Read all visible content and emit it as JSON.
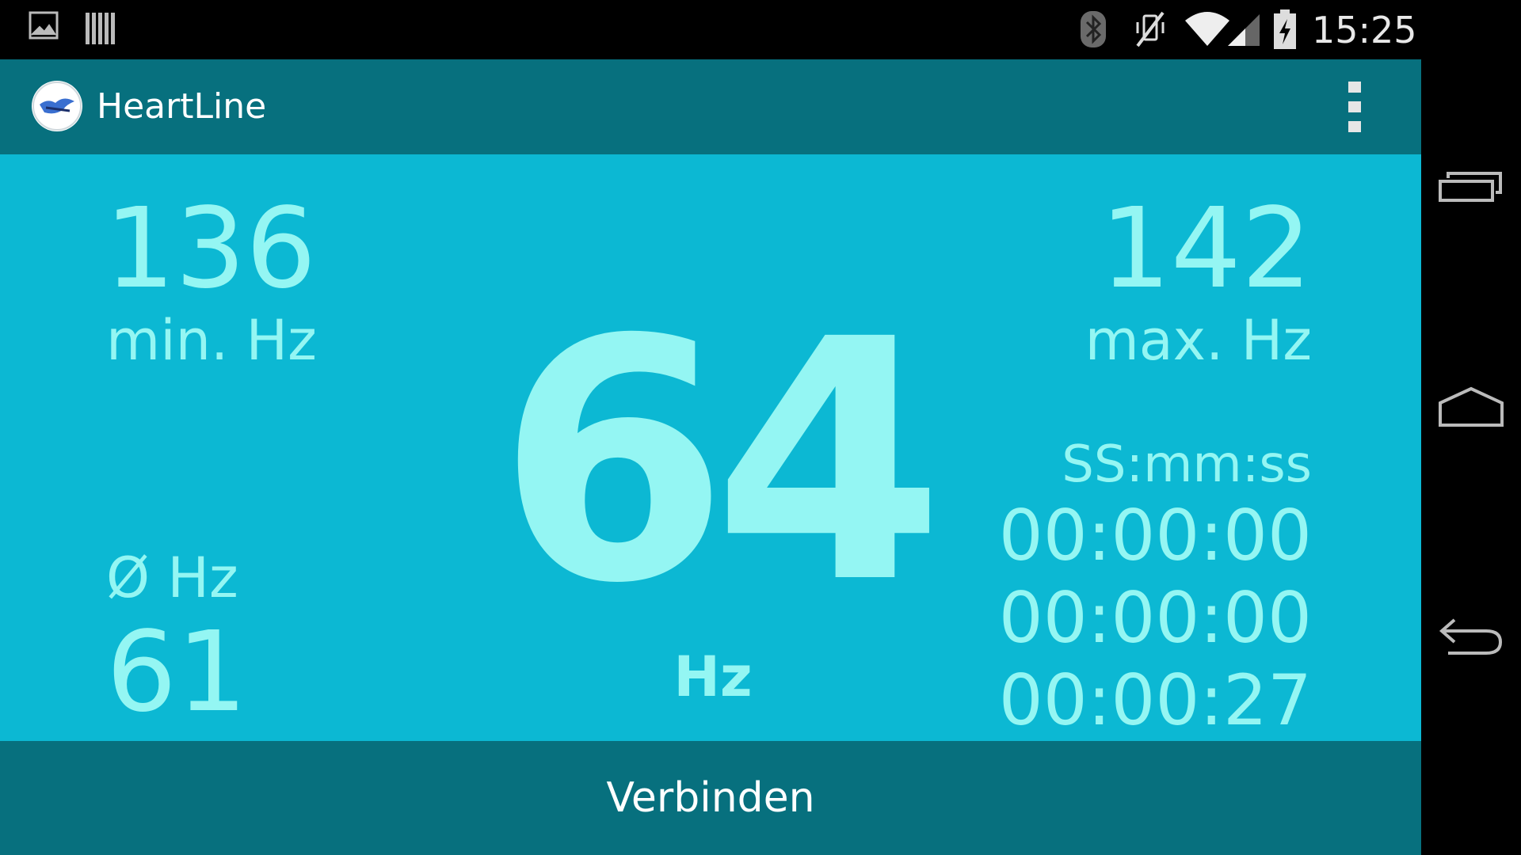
{
  "status_bar": {
    "time": "15:25",
    "icons": [
      "image-icon",
      "barcode-icon",
      "bluetooth-icon",
      "vibrate-off-icon",
      "wifi-icon",
      "signal-icon",
      "battery-charging-icon"
    ]
  },
  "app_bar": {
    "title": "HeartLine",
    "logo_icon": "app-logo-icon",
    "menu_icon": "overflow-menu-icon"
  },
  "stats": {
    "min_value": "136",
    "min_label": "min. Hz",
    "max_value": "142",
    "max_label": "max. Hz",
    "avg_label": "Ø Hz",
    "avg_value": "61",
    "current_value": "64",
    "current_unit": "Hz"
  },
  "timers": {
    "format_label": "SS:mm:ss",
    "values": [
      "00:00:00",
      "00:00:00",
      "00:00:27"
    ]
  },
  "bottom_bar": {
    "connect_label": "Verbinden"
  },
  "nav_bar": {
    "icons": [
      "recent-apps-icon",
      "home-icon",
      "back-icon"
    ]
  },
  "colors": {
    "app_bar": "#07707e",
    "content_bg": "#0cb8d3",
    "text_accent": "#94f6f3",
    "status_bar": "#000000"
  }
}
